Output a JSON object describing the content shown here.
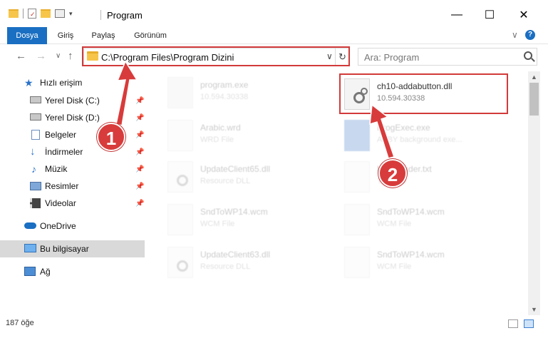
{
  "window": {
    "title": "Program",
    "minimize": "—",
    "maximize": "☐",
    "close": "✕"
  },
  "ribbon": {
    "tabs": [
      "Dosya",
      "Giriş",
      "Paylaş",
      "Görünüm"
    ],
    "collapse": "∨",
    "help": "?"
  },
  "nav": {
    "back": "←",
    "forward": "→",
    "recent": "∨",
    "up": "↑",
    "address": "C:\\Program Files\\Program Dizini",
    "address_dropdown": "∨",
    "refresh": "↻",
    "search_placeholder": "Ara: Program"
  },
  "sidebar": {
    "items": [
      {
        "label": "Hızlı erişim",
        "icon": "star-icon"
      },
      {
        "label": "Yerel Disk (C:)",
        "icon": "drive-icon",
        "pinned": true
      },
      {
        "label": "Yerel Disk (D:)",
        "icon": "drive-icon",
        "pinned": true
      },
      {
        "label": "Belgeler",
        "icon": "documents-icon",
        "pinned": true
      },
      {
        "label": "İndirmeler",
        "icon": "download-icon",
        "pinned": true
      },
      {
        "label": "Müzik",
        "icon": "music-icon",
        "pinned": true
      },
      {
        "label": "Resimler",
        "icon": "pictures-icon",
        "pinned": true
      },
      {
        "label": "Videolar",
        "icon": "videos-icon",
        "pinned": true
      },
      {
        "label": "OneDrive",
        "icon": "cloud-icon"
      },
      {
        "label": "Bu bilgisayar",
        "icon": "computer-icon",
        "selected": true
      },
      {
        "label": "Ağ",
        "icon": "network-icon"
      }
    ],
    "pin_glyph": "📌"
  },
  "files": [
    {
      "name": "program.exe",
      "sub": "10.594.30338",
      "faded": true
    },
    {
      "name": "ch10-addabutton.dll",
      "sub": "10.594.30338",
      "faded": false
    },
    {
      "name": "Arabic.wrd",
      "sub": "WRD File",
      "faded": true
    },
    {
      "name": "ProgExec.exe",
      "sub": "ABBY background exe...",
      "faded": true
    },
    {
      "name": "UpdateClient65.dll",
      "sub": "Resource DLL",
      "faded": true
    },
    {
      "name": "hwnReader.txt",
      "sub": "TXT File",
      "faded": true
    },
    {
      "name": "SndToWP14.wcm",
      "sub": "WCM File",
      "faded": true
    },
    {
      "name": "SndToWP14.wcm",
      "sub": "WCM File",
      "faded": true
    },
    {
      "name": "UpdateClient63.dll",
      "sub": "Resource DLL",
      "faded": true
    },
    {
      "name": "SndToWP14.wcm",
      "sub": "WCM File",
      "faded": true
    }
  ],
  "annotations": {
    "badge1": "1",
    "badge2": "2"
  },
  "status": {
    "count": "187 öğe"
  },
  "colors": {
    "accent": "#1a6fc2",
    "highlight_red": "#d23a3a",
    "selected_bg": "#d9d9d9"
  }
}
